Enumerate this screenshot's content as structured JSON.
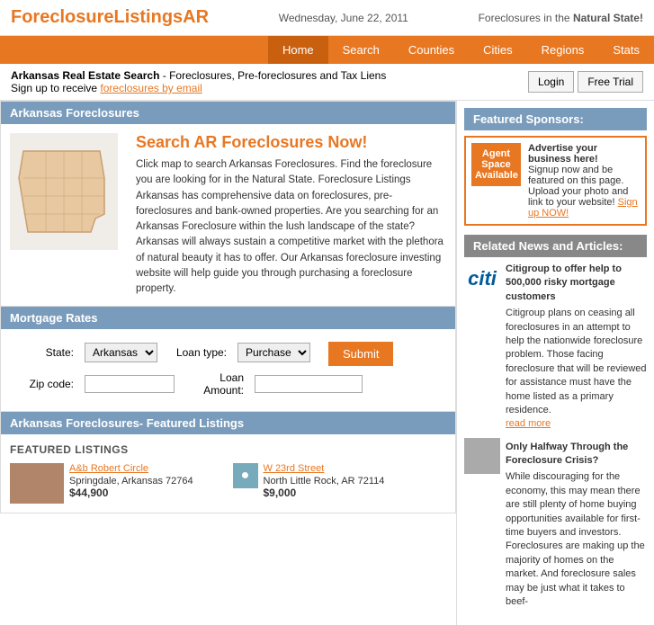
{
  "header": {
    "logo": "ForeclosureListingsAR",
    "date": "Wednesday, June 22, 2011",
    "tagline": "Foreclosures in the ",
    "tagline_strong": "Natural State!"
  },
  "nav": {
    "items": [
      {
        "label": "Home",
        "active": true
      },
      {
        "label": "Search",
        "active": false
      },
      {
        "label": "Counties",
        "active": false
      },
      {
        "label": "Cities",
        "active": false
      },
      {
        "label": "Regions",
        "active": false
      },
      {
        "label": "Stats",
        "active": false
      }
    ]
  },
  "subheader": {
    "text": "Arkansas Real Estate Search",
    "subtitle": " - Foreclosures, Pre-foreclosures and Tax Liens",
    "signup": "Sign up to receive ",
    "signup_link": "foreclosures by email",
    "login_btn": "Login",
    "trial_btn": "Free Trial"
  },
  "foreclosure_section": {
    "header": "Arkansas Foreclosures",
    "title": "Search AR Foreclosures Now!",
    "body": "Click map to search Arkansas Foreclosures. Find the foreclosure you are looking for in the Natural State. Foreclosure Listings Arkansas has comprehensive data on foreclosures, pre-foreclosures and bank-owned properties. Are you searching for an Arkansas Foreclosure within the lush landscape of the state? Arkansas will always sustain a competitive market with the plethora of natural beauty it has to offer. Our Arkansas foreclosure investing website will help guide you through purchasing a foreclosure property."
  },
  "mortgage_section": {
    "header": "Mortgage Rates",
    "state_label": "State:",
    "state_value": "Arkansas",
    "loan_type_label": "Loan type:",
    "loan_type_value": "Purchase",
    "zip_label": "Zip code:",
    "loan_amount_label": "Loan Amount:",
    "submit_label": "Submit"
  },
  "featured_section": {
    "header": "Arkansas Foreclosures- Featured Listings",
    "subheader": "FEATURED LISTINGS",
    "listings": [
      {
        "title": "A&b Robert Circle",
        "address": "Springdale, Arkansas 72764",
        "price": "$44,900"
      },
      {
        "title": "W 23rd Street",
        "address": "North Little Rock, AR 72114",
        "price": "$9,000"
      }
    ]
  },
  "right_col": {
    "sponsors_header": "Featured Sponsors:",
    "agent_badge_line1": "Agent",
    "agent_badge_line2": "Space",
    "agent_badge_line3": "Available",
    "sponsor_title": "Advertise your business here!",
    "sponsor_body": "Signup now and be featured on this page. Upload your photo and link to your website! ",
    "sponsor_link": "Sign up NOW!",
    "news_header": "Related News and Articles:",
    "news": [
      {
        "type": "citi",
        "title": "Citigroup to offer help to 500,000 risky mortgage customers",
        "body": "Citigroup plans on ceasing all foreclosures in an attempt to help the nationwide foreclosure problem. Those facing foreclosure that will be reviewed for assistance must have the home listed as a primary residence.",
        "read_more": "read more"
      },
      {
        "type": "img",
        "title": "Only Halfway Through the Foreclosure Crisis?",
        "body": "While discouraging for the economy, this may mean there are still plenty of home buying opportunities available for first-time buyers and investors. Foreclosures are making up the majority of homes on the market. And foreclosure sales may be just what it takes to beef-",
        "read_more": ""
      }
    ]
  }
}
